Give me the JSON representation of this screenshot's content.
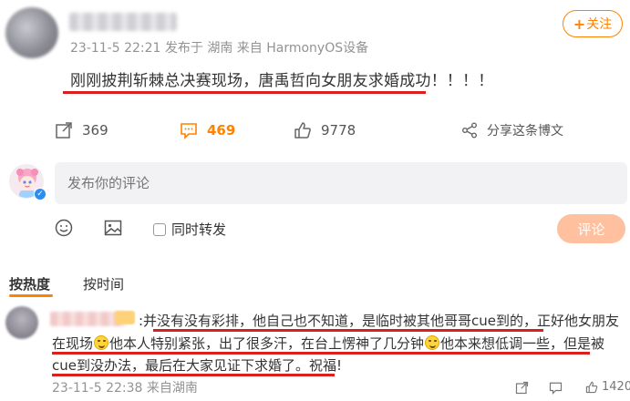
{
  "post": {
    "meta": "23-11-5 22:21  发布于 湖南  来自 HarmonyOS设备",
    "text": "刚刚披荆斩棘总决赛现场，唐禹哲向女朋友求婚成功！！！！",
    "follow_label": "关注",
    "follow_plus": "+"
  },
  "actions": {
    "repost_count": "369",
    "comment_count": "469",
    "like_count": "9778",
    "share_label": "分享这条博文"
  },
  "comment_box": {
    "placeholder": "发布你的评论",
    "repost_label": "同时转发",
    "submit_label": "评论"
  },
  "sort": {
    "hot_label": "按热度",
    "time_label": "按时间"
  },
  "comment": {
    "line1": ":并没有没有彩排，他自己也不知道，是临时被其他哥哥cue到的，正好他女朋友",
    "line2a": "在现场",
    "line2b": "他本人特别紧张，出了很多汗，在台上愣神了几分钟",
    "line2c": "他本来想低调一些，但是被",
    "line3": "cue到没办法，最后在大家见证下求婚了。祝福!",
    "meta": "23-11-5 22:38  来自湖南",
    "like_count": "1420"
  },
  "colors": {
    "accent": "#ff8200",
    "underline": "#d9201f",
    "submit_disabled": "#ffc09f"
  }
}
